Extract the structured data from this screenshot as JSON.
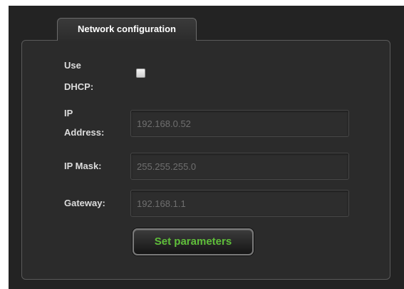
{
  "tab": {
    "label": "Network configuration"
  },
  "form": {
    "dhcp": {
      "label_line1": "Use",
      "label_line2": "DHCP:",
      "checked": false
    },
    "ip_address": {
      "label_line1": "IP",
      "label_line2": "Address:",
      "value": "192.168.0.52"
    },
    "ip_mask": {
      "label": "IP Mask:",
      "value": "255.255.255.0"
    },
    "gateway": {
      "label": "Gateway:",
      "value": "192.168.1.1"
    },
    "submit": {
      "label": "Set parameters"
    }
  },
  "colors": {
    "background": "#232323",
    "panel": "#2b2b2b",
    "label_text": "#dcdcdc",
    "field_text": "#6f6f6f",
    "button_text": "#5fbe3a"
  }
}
